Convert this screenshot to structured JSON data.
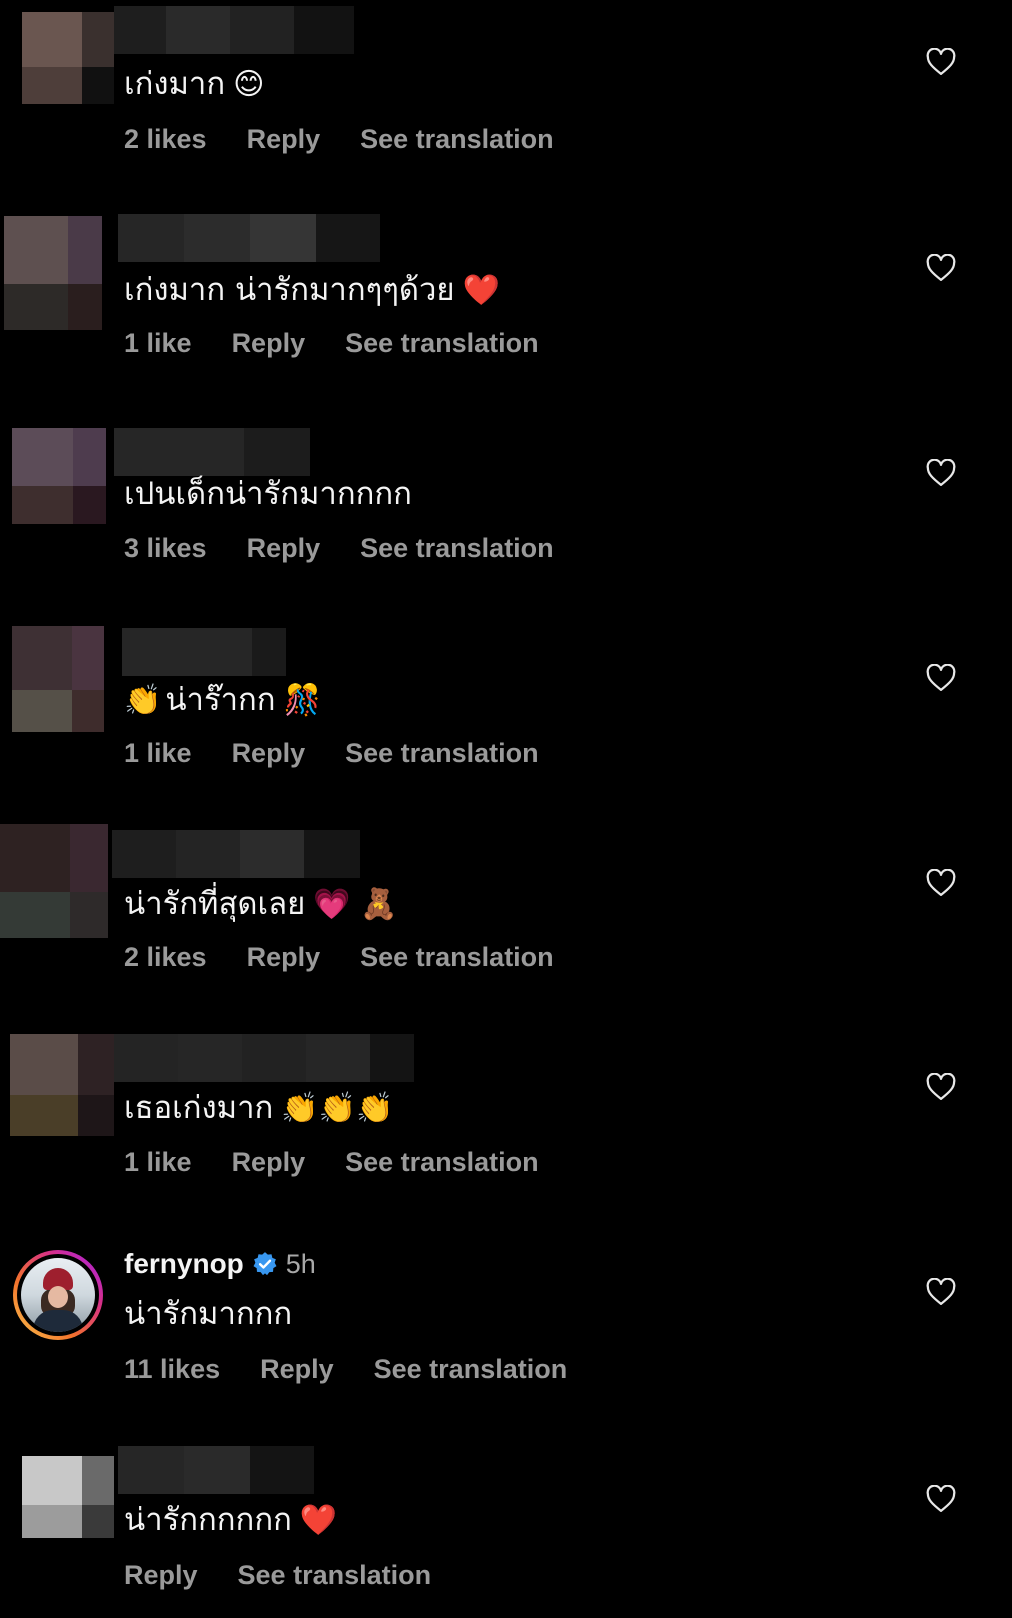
{
  "comments": [
    {
      "text": "เก่งมาก",
      "emoji": "😊",
      "likes": "2 likes",
      "reply": "Reply",
      "translate": "See translation"
    },
    {
      "text": "เก่งมาก น่ารักมากๆๆด้วย",
      "emoji": "❤️",
      "likes": "1 like",
      "reply": "Reply",
      "translate": "See translation"
    },
    {
      "text": "เปนเด็กน่ารักมากกกก",
      "emoji": "",
      "likes": "3 likes",
      "reply": "Reply",
      "translate": "See translation"
    },
    {
      "text": "น่าร๊ากก",
      "emoji_before": "👏",
      "emoji": "🎊",
      "likes": "1 like",
      "reply": "Reply",
      "translate": "See translation"
    },
    {
      "text": "น่ารักที่สุดเลย",
      "emoji": "💗 🧸",
      "likes": "2 likes",
      "reply": "Reply",
      "translate": "See translation"
    },
    {
      "text": "เธอเก่งมาก",
      "emoji": "👏👏👏",
      "likes": "1 like",
      "reply": "Reply",
      "translate": "See translation"
    },
    {
      "username": "fernynop",
      "time": "5h",
      "text": "น่ารักมากกก",
      "likes": "11 likes",
      "reply": "Reply",
      "translate": "See translation"
    },
    {
      "text": "น่ารักกกกกก",
      "emoji": "❤️",
      "reply": "Reply",
      "translate": "See translation"
    }
  ],
  "colors": {
    "background": "#000000",
    "text": "#f4f4f4",
    "muted": "#9a9a9a",
    "verified": "#3897f0"
  },
  "icons": {
    "like": "heart-outline-icon",
    "verified": "verified-badge-icon"
  }
}
